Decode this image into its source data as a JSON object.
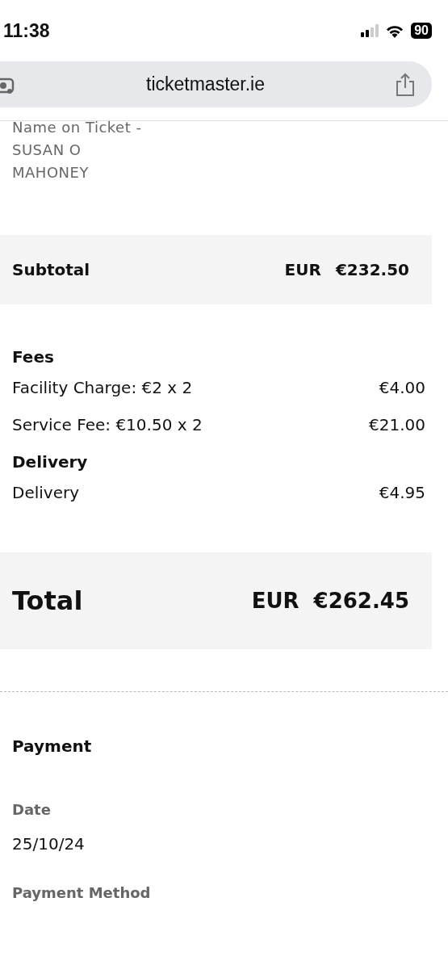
{
  "status_bar": {
    "time": "11:38",
    "battery": "90"
  },
  "address_bar": {
    "url": "ticketmaster.ie"
  },
  "ticket_name": "Name on Ticket - SUSAN O MAHONEY",
  "subtotal": {
    "label": "Subtotal",
    "currency": "EUR",
    "amount": "€232.50"
  },
  "sections": [
    {
      "title": "Fees",
      "rows": [
        {
          "label": "Facility Charge: €2 x 2",
          "amount": "€4.00"
        },
        {
          "label": "Service Fee: €10.50 x 2",
          "amount": "€21.00"
        }
      ]
    },
    {
      "title": "Delivery",
      "rows": [
        {
          "label": "Delivery",
          "amount": "€4.95"
        }
      ]
    }
  ],
  "total": {
    "label": "Total",
    "currency": "EUR",
    "amount": "€262.45"
  },
  "payment": {
    "title": "Payment",
    "fields": [
      {
        "label": "Date",
        "value": "25/10/24"
      },
      {
        "label": "Payment Method"
      }
    ]
  }
}
